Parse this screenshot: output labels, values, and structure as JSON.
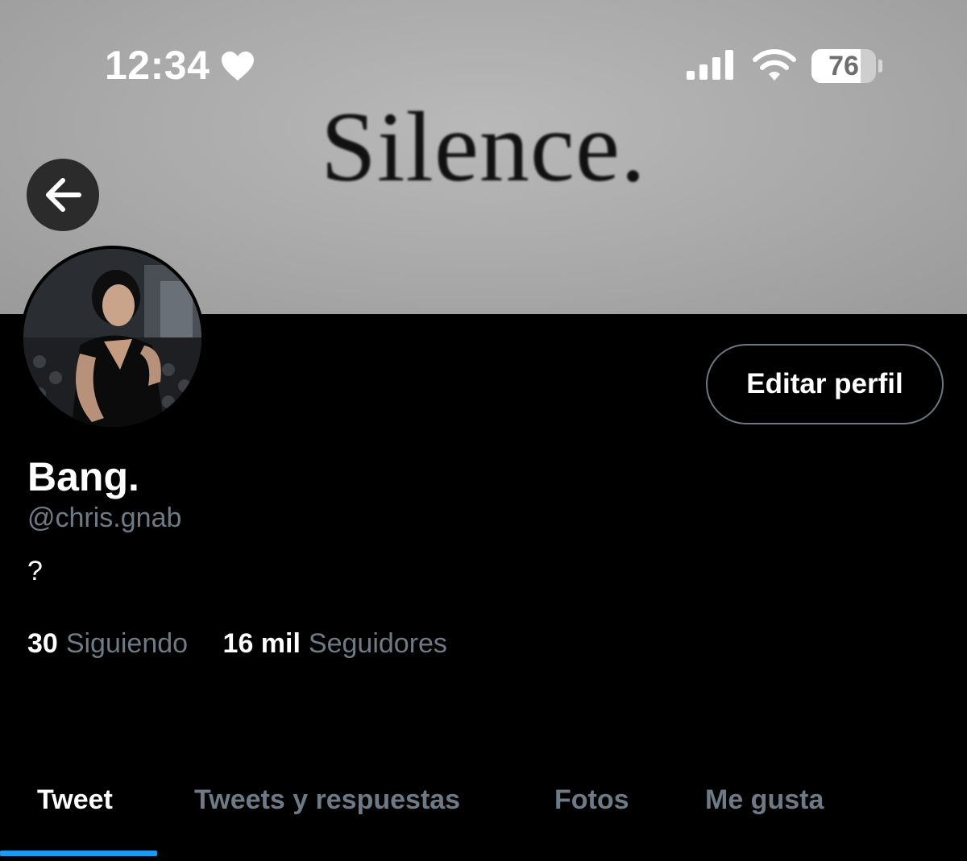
{
  "status_bar": {
    "time": "12:34",
    "battery_level": "76",
    "battery_fraction": 0.76
  },
  "banner": {
    "text": "Silence."
  },
  "profile": {
    "display_name": "Bang.",
    "handle": "@chris.gnab",
    "bio": "?",
    "edit_label": "Editar perfil",
    "following_count": "30",
    "following_label": "Siguiendo",
    "followers_count": "16 mil",
    "followers_label": "Seguidores"
  },
  "tabs": [
    {
      "label": "Tweet",
      "active": true
    },
    {
      "label": "Tweets y respuestas",
      "active": false
    },
    {
      "label": "Fotos",
      "active": false
    },
    {
      "label": "Me gusta",
      "active": false
    }
  ],
  "colors": {
    "accent": "#1d9bf0",
    "muted_text": "#6e7a85",
    "background": "#000000"
  },
  "icons": [
    "heart-icon",
    "cellular-signal-icon",
    "wifi-icon",
    "battery-icon",
    "back-arrow-icon"
  ]
}
